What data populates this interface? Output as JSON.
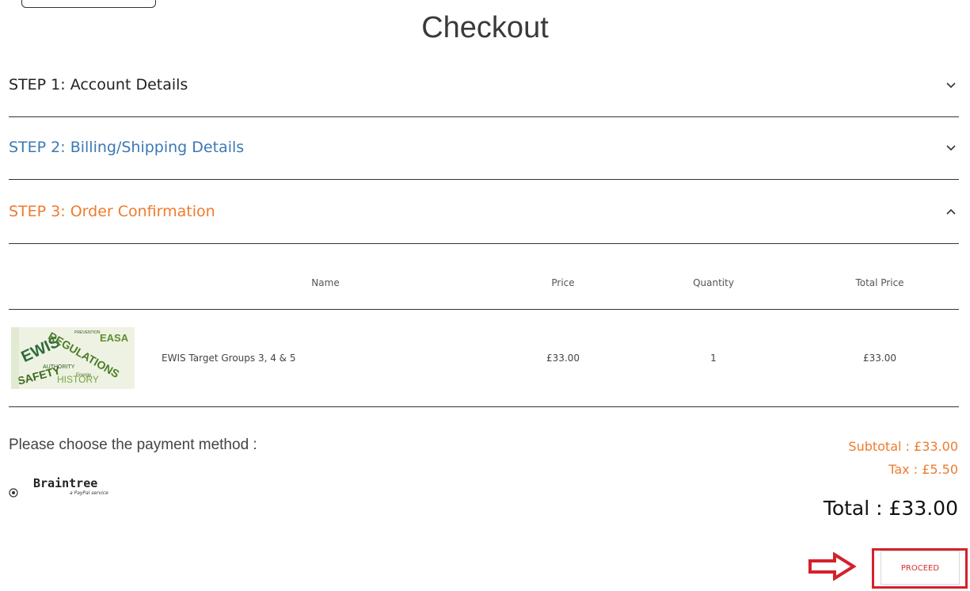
{
  "page": {
    "title": "Checkout"
  },
  "steps": [
    {
      "label": "STEP 1: Account Details",
      "state": "collapsed"
    },
    {
      "label": "STEP 2: Billing/Shipping Details",
      "state": "collapsed"
    },
    {
      "label": "STEP 3: Order Confirmation",
      "state": "expanded"
    }
  ],
  "colors": {
    "step2": "#3c78b5",
    "accent_orange": "#ee7b2f",
    "highlight_red": "#d3222a"
  },
  "table": {
    "headers": {
      "name": "Name",
      "price": "Price",
      "quantity": "Quantity",
      "total_price": "Total Price"
    },
    "rows": [
      {
        "name": "EWIS Target Groups 3, 4 & 5",
        "price": "£33.00",
        "quantity": "1",
        "total_price": "£33.00"
      }
    ]
  },
  "thumbnail_words": [
    "EWIS",
    "REGULATIONS",
    "SAFETY",
    "EASA",
    "HISTORY",
    "AUTHORITY",
    "PREVENTION",
    "Energy"
  ],
  "payment": {
    "prompt": "Please choose the payment method :",
    "method": "Braintree",
    "method_sub": "a PayPal service"
  },
  "summary": {
    "subtotal": "Subtotal : £33.00",
    "tax": "Tax : £5.50",
    "total": "Total : £33.00"
  },
  "actions": {
    "proceed_label": "PROCEED"
  },
  "icons": {
    "chevron_collapsed": "chevron-down-icon",
    "chevron_expanded": "chevron-up-icon",
    "pointer": "right-arrow-icon"
  }
}
